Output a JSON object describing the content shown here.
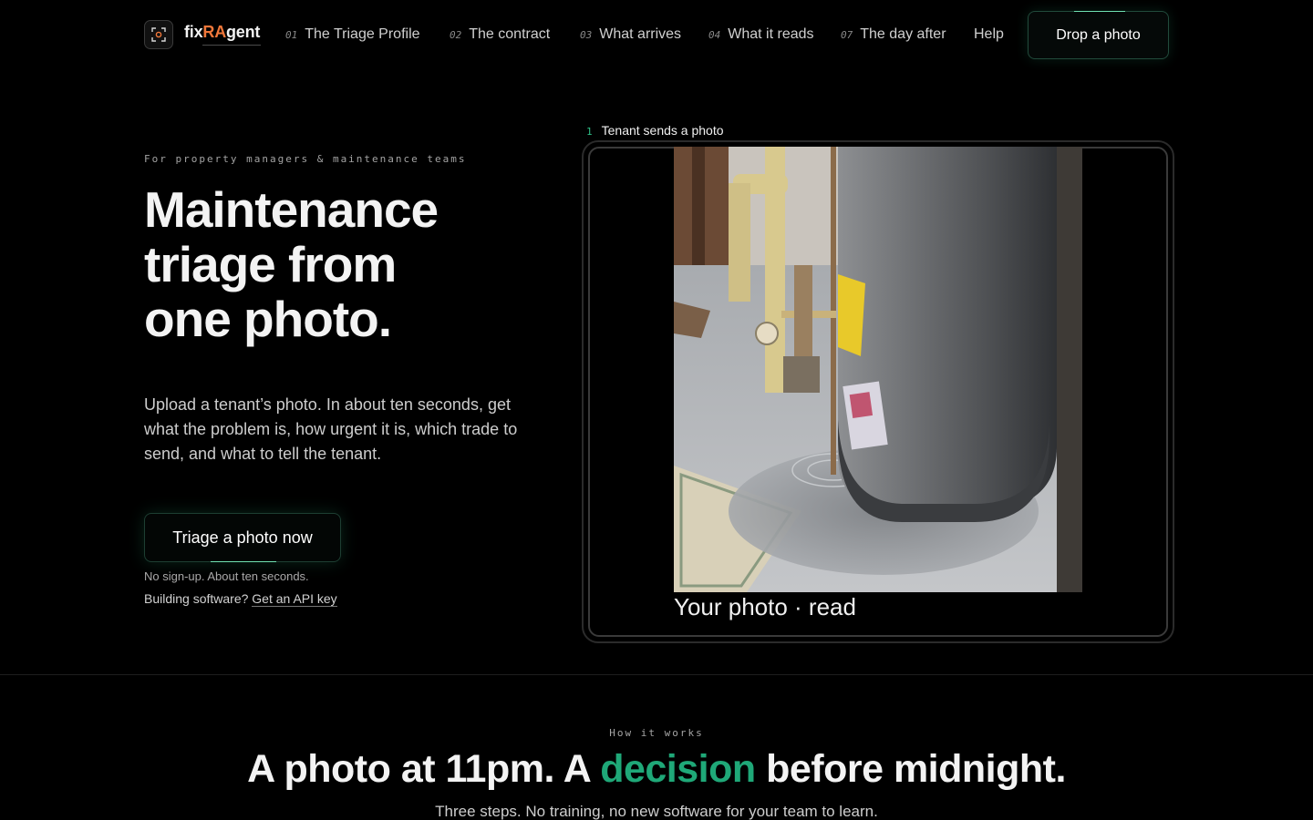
{
  "nav": {
    "logo": {
      "prefix": "fix",
      "highlight": "RA",
      "suffix": "gent",
      "icon": "focus-scan-icon"
    },
    "links": [
      {
        "num": "01",
        "label": "The Triage Profile"
      },
      {
        "num": "02",
        "label": "The contract"
      },
      {
        "num": "03",
        "label": "What arrives"
      },
      {
        "num": "04",
        "label": "What it reads"
      },
      {
        "num": "07",
        "label": "The day after"
      },
      {
        "num": "",
        "label": "Help"
      }
    ],
    "cta": "Drop a photo"
  },
  "hero": {
    "eyebrow": "For property managers & maintenance teams",
    "headline_1": "Maintenance",
    "headline_2": "triage from",
    "headline_3": "one photo.",
    "subcopy": "Upload a tenant’s photo. In about ten seconds, get what the problem is, how urgent it is, which trade to send, and what to tell the tenant.",
    "cta": "Triage a photo now",
    "note": "No sign-up. About ten seconds.",
    "api_prefix": "Building software?",
    "api_link": "Get an API key"
  },
  "preview": {
    "step_num": "1",
    "step_label": "Tenant sends a photo",
    "caption": "Your photo · read"
  },
  "how": {
    "eyebrow": "How it works",
    "title_pre": "A photo at 11pm. A",
    "title_accent": "decision",
    "title_post": "before midnight.",
    "sub": "Three steps. No training, no new software for your team to learn."
  },
  "colors": {
    "accent_green": "#1fa878",
    "logo_orange": "#f0773a",
    "background": "#000000"
  }
}
